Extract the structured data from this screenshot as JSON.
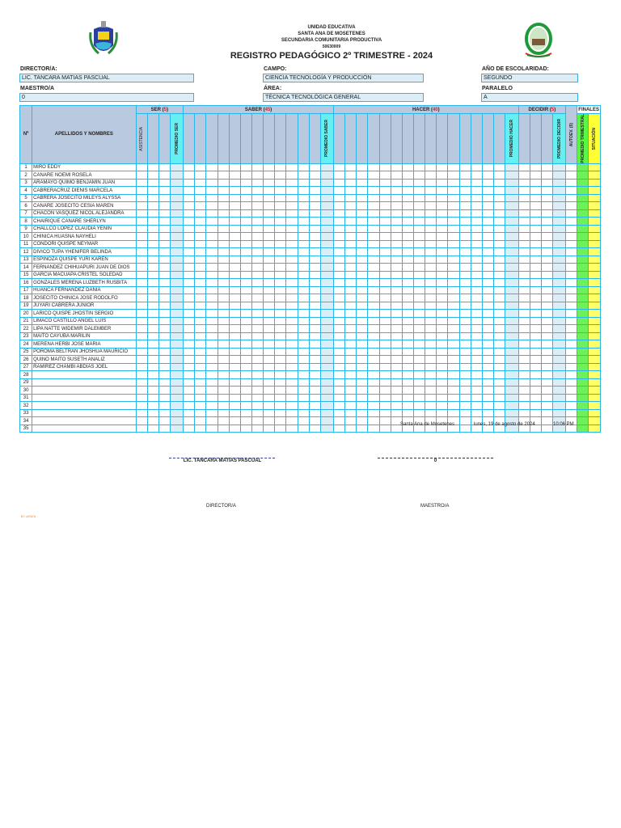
{
  "header": {
    "line1": "UNIDAD EDUCATIVA",
    "line2": "SANTA ANA DE MOSETENES",
    "line3": "SECUNDARIA COMUNITARIA PRODUCTIVA",
    "code": "50630009",
    "title": "REGISTRO PEDAGÓGICO 2º TRIMESTRE -  2024"
  },
  "fields": {
    "director_label": "DIRECTOR/A:",
    "director": "LIC. TANCARA MATIAS PASCUAL",
    "maestro_label": "MAESTRO/A",
    "maestro": "0",
    "campo_label": "CAMPO:",
    "campo": "CIENCIA TECNOLOGÍA Y PRODUCCIÓN",
    "area_label": "ÁREA:",
    "area": "TÉCNICA TECNOLÓGICA GENERAL",
    "anio_label": "AÑO DE ESCOLARIDAD:",
    "anio": "SEGUNDO",
    "paralelo_label": "PARALELO",
    "paralelo": "A"
  },
  "table": {
    "num_header": "Nº",
    "names_header": "APELLIDOS Y NOMBRES",
    "ser": {
      "label": "SER",
      "points": "5",
      "asistencia": "ASISTENCIA",
      "promedio": "PROMEDIO SER"
    },
    "saber": {
      "label": "SABER",
      "points": "45",
      "promedio": "PROMEDIO SABER"
    },
    "hacer": {
      "label": "HACER",
      "points": "40",
      "promedio": "PROMEDIO HACER"
    },
    "decidir": {
      "label": "DECIDIR",
      "points": "5",
      "promedio": "PROMEDIO DECIDIR"
    },
    "autoev": "AUTOEV. (5)",
    "finales": {
      "label": "FINALES",
      "promedio": "PROMEDIO TRIMESTRAL",
      "situacion": "SITUACIÓN"
    },
    "students": [
      "MIRO EDDY",
      "CANARE NOEMI ROSELA",
      "ARAMAYO QUIMO BENJAMIN JUAN",
      "CABRERACRUZ DIENIS MARCELA",
      "CABRERA JOSECITO MILEYS ALYSSA",
      "CANARE JOSECITO CESIA MAREN",
      "CHACON VASQUEZ NICOL ALEJANDRA",
      "CHAIRIQUE CANARE SHERLYN",
      "CHALLCO LOPEZ CLAUDIA YENIN",
      "CHINICA HUASNA NAYHELI",
      "CONDORI QUISPE NEYMAR",
      "DIVICO TUPA YHENIFER BELINDA",
      "ESPINOZA QUISPE YURI KAREN",
      "FERNANDEZ CHIHUAPURI JUAN DE DIOS",
      "GARCIA MACUAPA CRISTEL SOLEDAD",
      "GONZALES MERENA LUZBETH RUSBITA",
      "HUANCA FERNANDEZ DANIA",
      "JOSECITO CHINICA JOSE RODOLFO",
      "JUYARI CABRERA JUNIOR",
      "LARICO QUISPE JHOSTIN SERGIO",
      "LIMACO CASTILLO ANGEL LUIS",
      "LIPA NATTE WIDEMIR DALEMBER",
      "MAITO CAYUBA MARILIN",
      "MERENA HERBI JOSE MARIA",
      "POROMA BELTRAN JHOSHUA MAURICIO",
      "QUINO MAITO SUSETH ANALIZ",
      "RAMIREZ CHAMBI ABDIAS JOEL",
      "",
      "",
      "",
      "",
      "",
      "",
      "",
      ""
    ]
  },
  "footer": {
    "place": "Santa Ana de Mosetenes",
    "date": "lunes, 19 de agosto de 2024",
    "time": "10:06 PM",
    "director_name": "LIC. TANCARA MATIAS PASCUAL",
    "maestro_name": "0",
    "director_role": "DIRECTOR/A",
    "maestro_role": "MAESTRO/A",
    "credit": "BY: ARSEN"
  }
}
